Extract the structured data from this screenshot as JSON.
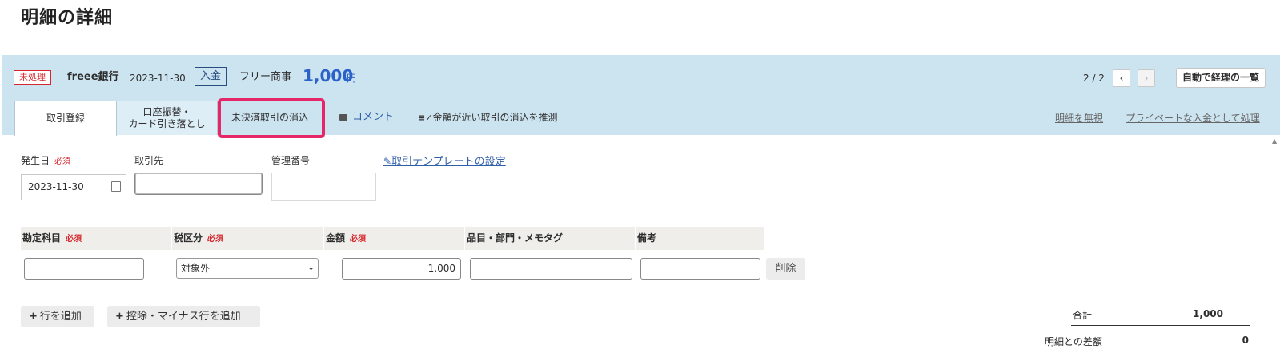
{
  "page": {
    "title": "明細の詳細"
  },
  "summary": {
    "status": "未処理",
    "bank": "freee銀行",
    "date": "2023-11-30",
    "direction": "入金",
    "partner": "フリー商事",
    "amount": "1,000",
    "currency": "円"
  },
  "pager": {
    "position": "2 / 2",
    "prev_icon": "chevron-left-icon",
    "next_icon": "chevron-right-icon",
    "prev_glyph": "‹",
    "next_glyph": "›",
    "list_button": "自動で経理の一覧"
  },
  "tabs": [
    {
      "label": "取引登録"
    },
    {
      "label": "口座振替・\nカード引き落とし"
    },
    {
      "label": "未決済取引の消込"
    }
  ],
  "links": {
    "comment": "コメント",
    "guess": "金額が近い取引の消込を推測",
    "ignore": "明細を無視",
    "private": "プライベートな入金として処理",
    "template": "取引テンプレートの設定"
  },
  "form": {
    "date_label": "発生日",
    "required": "必須",
    "date_value": "2023-11-30",
    "partner_label": "取引先",
    "partner_value": "",
    "mgmt_label": "管理番号",
    "mgmt_value": ""
  },
  "table": {
    "headers": [
      {
        "label": "勘定科目",
        "required": "必須"
      },
      {
        "label": "税区分",
        "required": "必須"
      },
      {
        "label": "金額",
        "required": "必須"
      },
      {
        "label": "品目・部門・メモタグ",
        "required": ""
      },
      {
        "label": "備考",
        "required": ""
      }
    ],
    "row": {
      "account": "",
      "tax": "対象外",
      "amount": "1,000",
      "tags": "",
      "memo": "",
      "delete": "削除"
    }
  },
  "actions": {
    "add_row": "行を追加",
    "add_minus_row": "控除・マイナス行を追加"
  },
  "totals": {
    "total_label": "合計",
    "total_value": "1,000",
    "diff_label": "明細との差額",
    "diff_value": "0"
  },
  "colors": {
    "accent": "#2a62c9",
    "band": "#cce4f0",
    "status_red": "#d7262b",
    "highlight": "#e5276a"
  }
}
